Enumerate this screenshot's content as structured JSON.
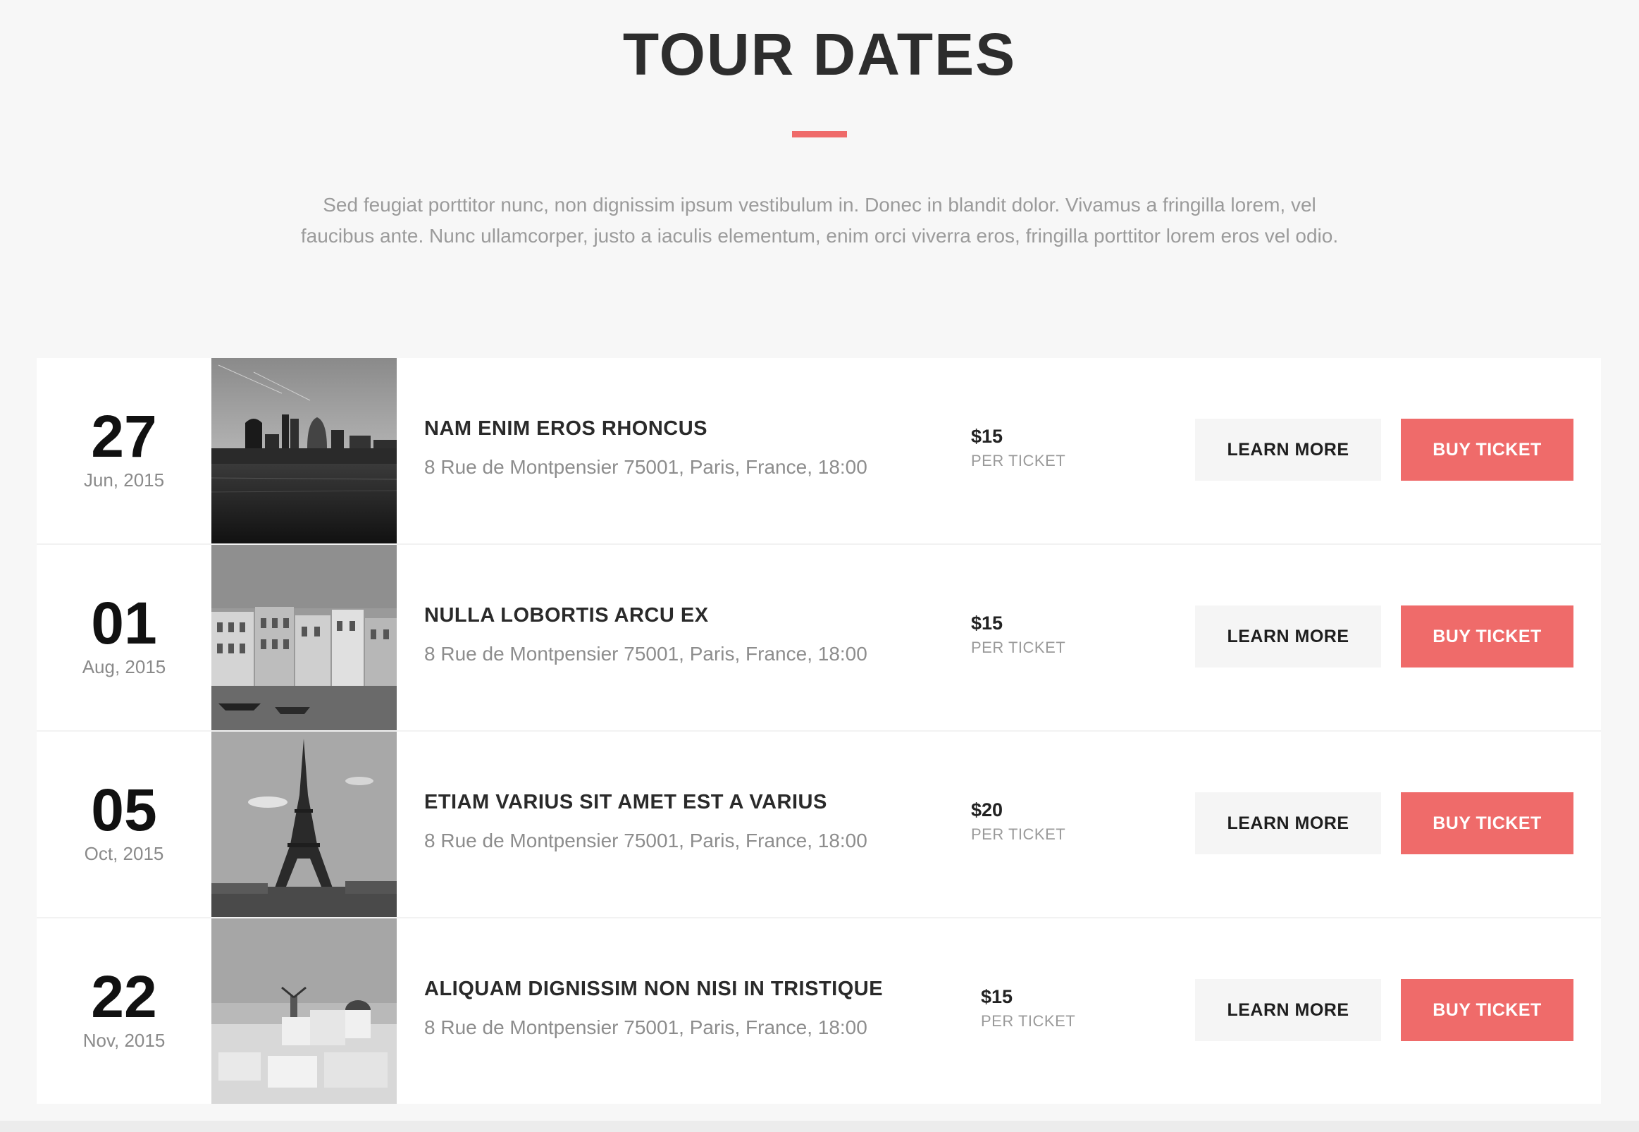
{
  "section": {
    "title": "TOUR DATES",
    "intro": "Sed feugiat porttitor nunc, non dignissim ipsum vestibulum in. Donec in blandit dolor. Vivamus a fringilla lorem, vel faucibus ante. Nunc ullamcorper, justo a iaculis elementum, enim orci viverra eros, fringilla porttitor lorem eros vel odio.",
    "accent_color": "#ef6b6a"
  },
  "events": [
    {
      "day": "27",
      "month": "Jun, 2015",
      "image": "london-skyline-photo",
      "name": "NAM ENIM EROS RHONCUS",
      "address": "8 Rue de Montpensier 75001, Paris, France, 18:00",
      "price": "$15",
      "price_unit": "PER TICKET",
      "learn_label": "LEARN MORE",
      "buy_label": "BUY TICKET"
    },
    {
      "day": "01",
      "month": "Aug, 2015",
      "image": "venice-canal-photo",
      "name": "NULLA LOBORTIS ARCU EX",
      "address": "8 Rue de Montpensier 75001, Paris, France, 18:00",
      "price": "$15",
      "price_unit": "PER TICKET",
      "learn_label": "LEARN MORE",
      "buy_label": "BUY TICKET"
    },
    {
      "day": "05",
      "month": "Oct, 2015",
      "image": "eiffel-tower-photo",
      "name": "ETIAM VARIUS SIT AMET EST A VARIUS",
      "address": "8 Rue de Montpensier 75001, Paris, France, 18:00",
      "price": "$20",
      "price_unit": "PER TICKET",
      "learn_label": "LEARN MORE",
      "buy_label": "BUY TICKET"
    },
    {
      "day": "22",
      "month": "Nov, 2015",
      "image": "santorini-photo",
      "name": "ALIQUAM DIGNISSIM NON NISI IN TRISTIQUE",
      "address": "8 Rue de Montpensier 75001, Paris, France, 18:00",
      "price": "$15",
      "price_unit": "PER TICKET",
      "learn_label": "LEARN MORE",
      "buy_label": "BUY TICKET"
    }
  ]
}
